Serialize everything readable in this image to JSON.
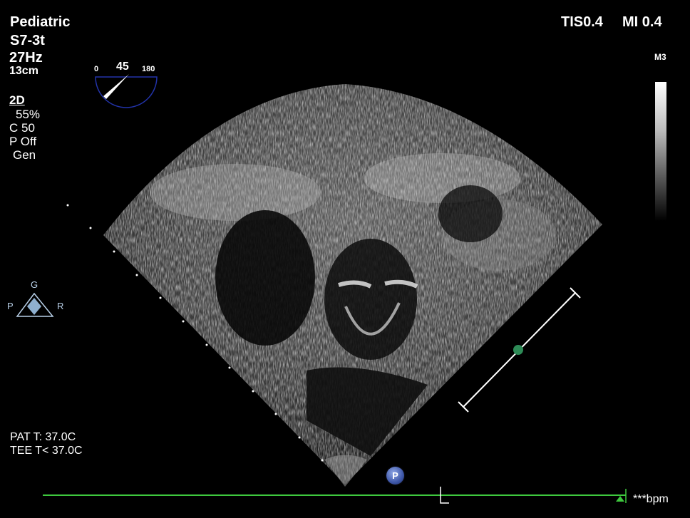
{
  "header": {
    "preset": "Pediatric",
    "probe": "S7-3t",
    "frame_rate": "27Hz",
    "depth": "13cm"
  },
  "imaging": {
    "mode": "2D",
    "gain": "55%",
    "compress": "C 50",
    "persist": "P Off",
    "frequency": "Gen"
  },
  "safety": {
    "tis": "TIS0.4",
    "mi": "MI 0.4"
  },
  "map": {
    "label": "M3"
  },
  "probe_angle": {
    "min": "0",
    "value": "45",
    "max": "180"
  },
  "orientation": {
    "top": "G",
    "left": "P",
    "right": "R"
  },
  "temperatures": {
    "patient": "PAT T: 37.0C",
    "tee": "TEE T< 37.0C"
  },
  "ecg": {
    "heart_rate": "***bpm",
    "trace_color": "#3ec83e"
  },
  "controls": {
    "p_button": "P"
  },
  "colors": {
    "background": "#000000",
    "text": "#ffffff",
    "focus_marker": "#2e8b57",
    "angle_dial": "#2233aa"
  }
}
